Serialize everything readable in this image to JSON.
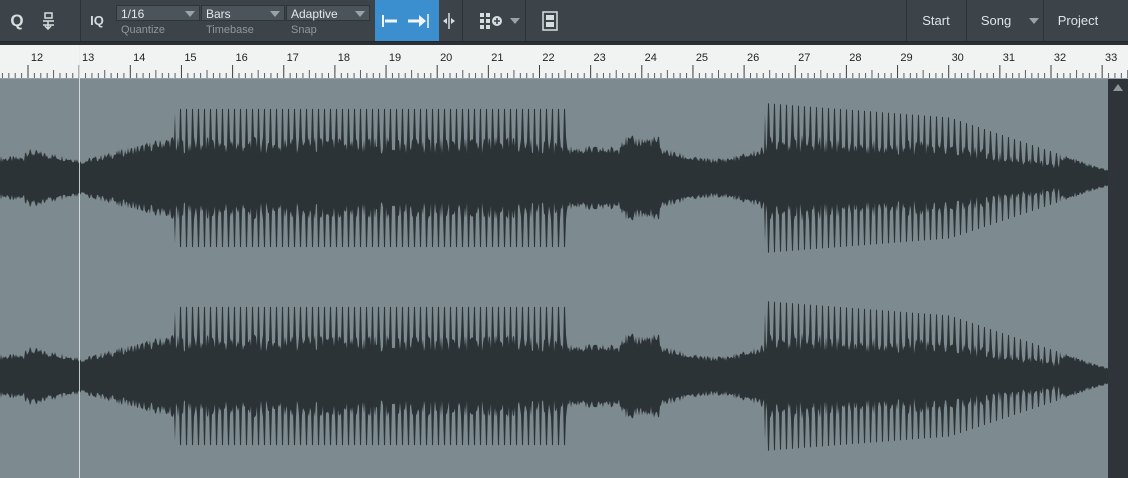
{
  "toolbar": {
    "quantize_button": "Q",
    "iq_button": "IQ",
    "quantize": {
      "value": "1/16",
      "label": "Quantize"
    },
    "timebase": {
      "value": "Bars",
      "label": "Timebase"
    },
    "snap": {
      "value": "Adaptive",
      "label": "Snap"
    },
    "nav": {
      "start": "Start",
      "song": "Song",
      "project": "Project"
    },
    "accent_color": "#3b8fcf"
  },
  "ruler": {
    "bars": [
      "12",
      "13",
      "14",
      "15",
      "16",
      "17",
      "18",
      "19",
      "20",
      "21",
      "22",
      "23",
      "24",
      "25",
      "26",
      "27",
      "28",
      "29",
      "30",
      "31",
      "32",
      "33"
    ]
  },
  "icons": [
    "quantize-icon",
    "input-quantize-icon",
    "snap-start-icon",
    "snap-arrow-icon",
    "split-icon",
    "grid-add-icon",
    "chevron-down-icon",
    "video-icon",
    "scroll-up-icon"
  ]
}
